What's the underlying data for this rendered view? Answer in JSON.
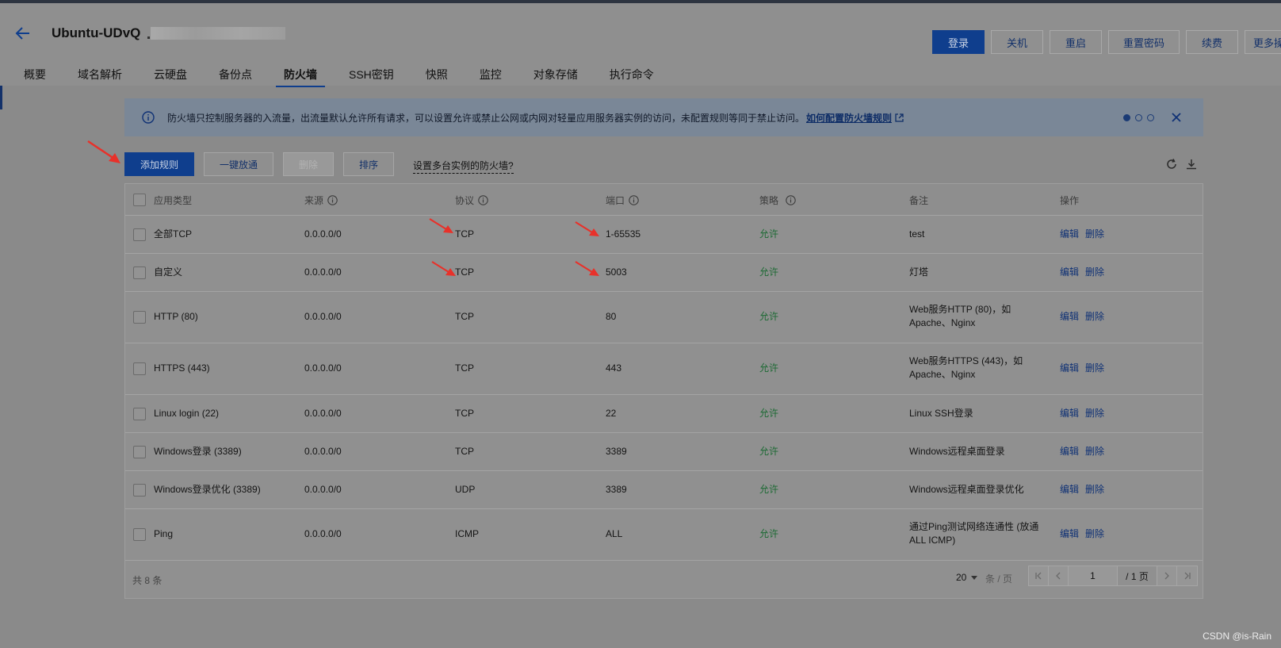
{
  "header": {
    "title": "Ubuntu-UDvQ",
    "buttons": [
      "登录",
      "关机",
      "重启",
      "重置密码",
      "续费",
      "更多操"
    ]
  },
  "tabs": [
    "概要",
    "域名解析",
    "云硬盘",
    "备份点",
    "防火墙",
    "SSH密钥",
    "快照",
    "监控",
    "对象存储",
    "执行命令"
  ],
  "active_tab": "防火墙",
  "notice": {
    "text": "防火墙只控制服务器的入流量，出流量默认允许所有请求，可以设置允许或禁止公网或内网对轻量应用服务器实例的访问，未配置规则等同于禁止访问。",
    "link": "如何配置防火墙规则"
  },
  "toolbar": {
    "add_rule": "添加规则",
    "one_click": "一键放通",
    "delete": "删除",
    "sort": "排序",
    "multi_instance": "设置多台实例的防火墙?"
  },
  "table": {
    "columns": [
      "应用类型",
      "来源",
      "协议",
      "端口",
      "策略",
      "备注",
      "操作"
    ],
    "rows": [
      {
        "app": "全部TCP",
        "source": "0.0.0.0/0",
        "protocol": "TCP",
        "port": "1-65535",
        "policy": "允许",
        "remark1": "test",
        "remark2": ""
      },
      {
        "app": "自定义",
        "source": "0.0.0.0/0",
        "protocol": "TCP",
        "port": "5003",
        "policy": "允许",
        "remark1": "灯塔",
        "remark2": ""
      },
      {
        "app": "HTTP (80)",
        "source": "0.0.0.0/0",
        "protocol": "TCP",
        "port": "80",
        "policy": "允许",
        "remark1": "Web服务HTTP (80)，如",
        "remark2": "Apache、Nginx"
      },
      {
        "app": "HTTPS (443)",
        "source": "0.0.0.0/0",
        "protocol": "TCP",
        "port": "443",
        "policy": "允许",
        "remark1": "Web服务HTTPS (443)，如",
        "remark2": "Apache、Nginx"
      },
      {
        "app": "Linux login (22)",
        "source": "0.0.0.0/0",
        "protocol": "TCP",
        "port": "22",
        "policy": "允许",
        "remark1": "Linux SSH登录",
        "remark2": ""
      },
      {
        "app": "Windows登录 (3389)",
        "source": "0.0.0.0/0",
        "protocol": "TCP",
        "port": "3389",
        "policy": "允许",
        "remark1": "Windows远程桌面登录",
        "remark2": ""
      },
      {
        "app": "Windows登录优化 (3389)",
        "source": "0.0.0.0/0",
        "protocol": "UDP",
        "port": "3389",
        "policy": "允许",
        "remark1": "Windows远程桌面登录优化",
        "remark2": ""
      },
      {
        "app": "Ping",
        "source": "0.0.0.0/0",
        "protocol": "ICMP",
        "port": "ALL",
        "policy": "允许",
        "remark1": "通过Ping测试网络连通性 (放通",
        "remark2": "ALL ICMP)"
      }
    ],
    "actions": {
      "edit": "编辑",
      "delete": "删除"
    }
  },
  "footer": {
    "total": "共 8 条",
    "page_size": "20",
    "per_page": "条 / 页",
    "current_page": "1",
    "total_pages": "/ 1 页"
  },
  "watermark": "CSDN @is-Rain",
  "colors": {
    "primary": "#0f3e8d",
    "allow": "#1d6a34",
    "arrow": "#e8312a"
  }
}
